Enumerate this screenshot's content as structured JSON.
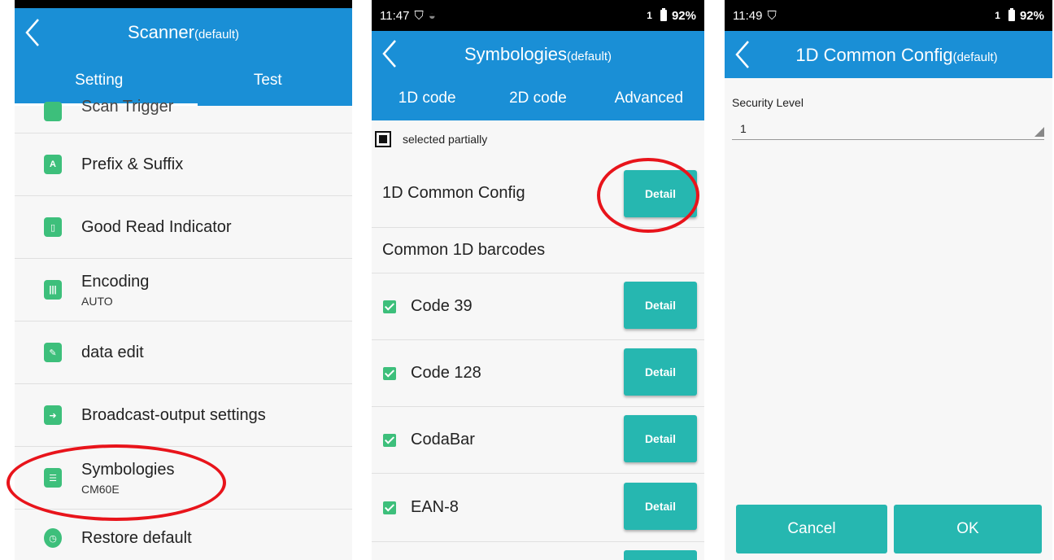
{
  "panel1": {
    "title": "Scanner",
    "title_suffix": "(default)",
    "tabs": [
      "Setting",
      "Test"
    ],
    "partial_item": "Scan Trigger",
    "items": [
      {
        "label": "Prefix & Suffix",
        "sub": "",
        "icon": "prefix-suffix-icon"
      },
      {
        "label": "Good Read Indicator",
        "sub": "",
        "icon": "good-read-icon"
      },
      {
        "label": "Encoding",
        "sub": "AUTO",
        "icon": "barcode-icon"
      },
      {
        "label": "data edit",
        "sub": "",
        "icon": "edit-icon"
      },
      {
        "label": "Broadcast-output settings",
        "sub": "",
        "icon": "broadcast-icon"
      },
      {
        "label": "Symbologies",
        "sub": "CM60E",
        "icon": "sliders-icon"
      },
      {
        "label": "Restore default",
        "sub": "",
        "icon": "clock-icon"
      }
    ]
  },
  "panel2": {
    "status_time": "11:47",
    "status_sim": "1",
    "status_battery": "92%",
    "title": "Symbologies",
    "title_suffix": "(default)",
    "tabs": [
      "1D code",
      "2D code",
      "Advanced"
    ],
    "select_state": "selected partially",
    "common_config": "1D Common Config",
    "section_title": "Common 1D barcodes",
    "detail_label": "Detail",
    "codes": [
      "Code 39",
      "Code 128",
      "CodaBar",
      "EAN-8"
    ]
  },
  "panel3": {
    "status_time": "11:49",
    "status_sim": "1",
    "status_battery": "92%",
    "title": "1D Common Config",
    "title_suffix": "(default)",
    "field_label": "Security Level",
    "field_value": "1",
    "cancel": "Cancel",
    "ok": "OK"
  },
  "colors": {
    "appbar": "#1a8fd6",
    "accent": "#26b7b0",
    "icon_green": "#3dbf7b",
    "highlight": "#e8141b"
  }
}
